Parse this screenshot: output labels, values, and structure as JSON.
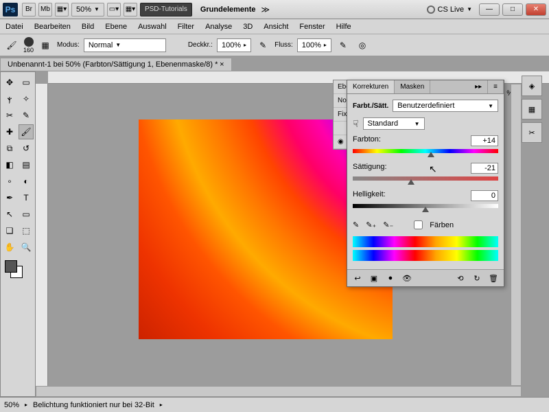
{
  "titlebar": {
    "br": "Br",
    "mb": "Mb",
    "zoom": "50%",
    "workspace_label": "PSD-Tutorials",
    "workspace2": "Grundelemente",
    "cslive": "CS Live"
  },
  "menu": [
    "Datei",
    "Bearbeiten",
    "Bild",
    "Ebene",
    "Auswahl",
    "Filter",
    "Analyse",
    "3D",
    "Ansicht",
    "Fenster",
    "Hilfe"
  ],
  "options": {
    "brush_size": "160",
    "mode_label": "Modus:",
    "mode_value": "Normal",
    "opacity_label": "Deckkr.:",
    "opacity_value": "100%",
    "flow_label": "Fluss:",
    "flow_value": "100%"
  },
  "doc_tab": "Unbenannt-1 bei 50% (Farbton/Sättigung 1, Ebenenmaske/8) *",
  "behind": {
    "t1": "Ebe",
    "t2": "Nor",
    "t3": "Fixie"
  },
  "panel": {
    "tabs": [
      "Korrekturen",
      "Masken"
    ],
    "title": "Farbt./Sätt.",
    "preset": "Benutzerdefiniert",
    "range": "Standard",
    "hue_label": "Farbton:",
    "hue_value": "+14",
    "sat_label": "Sättigung:",
    "sat_value": "-21",
    "lig_label": "Helligkeit:",
    "lig_value": "0",
    "colorize": "Färben"
  },
  "side_pct": "%",
  "status": {
    "zoom": "50%",
    "msg": "Belichtung funktioniert nur bei 32-Bit"
  }
}
